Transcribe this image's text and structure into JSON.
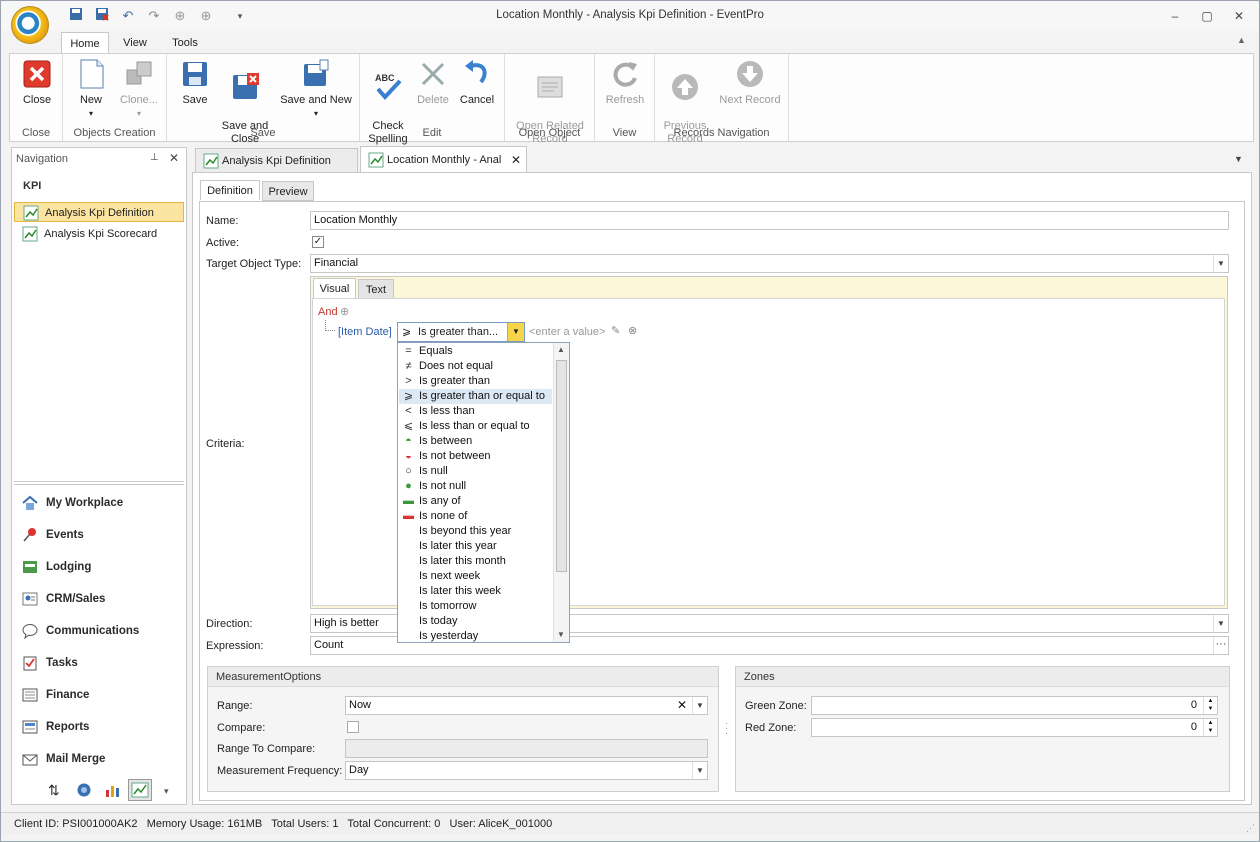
{
  "window": {
    "title": "Location Monthly - Analysis Kpi Definition - EventPro"
  },
  "ribbon_tabs": [
    "Home",
    "View",
    "Tools"
  ],
  "ribbon": {
    "close_group": {
      "label": "Close",
      "close": "Close"
    },
    "objects_group": {
      "label": "Objects Creation",
      "new": "New",
      "clone": "Clone..."
    },
    "save_group": {
      "label": "Save",
      "save": "Save",
      "save_close": "Save and\nClose",
      "save_new": "Save and New"
    },
    "edit_group": {
      "label": "Edit",
      "check": "Check\nSpelling",
      "delete": "Delete",
      "cancel": "Cancel"
    },
    "open_group": {
      "label": "Open Object",
      "open_related": "Open Related\nRecord"
    },
    "view_group": {
      "label": "View",
      "refresh": "Refresh"
    },
    "nav_group": {
      "label": "Records Navigation",
      "previous": "Previous\nRecord",
      "next": "Next Record"
    }
  },
  "navigation": {
    "header": "Navigation",
    "section": "KPI",
    "items": [
      "Analysis Kpi Definition",
      "Analysis Kpi Scorecard"
    ],
    "modules": [
      "My Workplace",
      "Events",
      "Lodging",
      "CRM/Sales",
      "Communications",
      "Tasks",
      "Finance",
      "Reports",
      "Mail Merge"
    ]
  },
  "doc_tabs": [
    "Analysis Kpi Definition",
    "Location Monthly - Anal"
  ],
  "sub_tabs": [
    "Definition",
    "Preview"
  ],
  "form": {
    "name_label": "Name:",
    "name_value": "Location Monthly",
    "active_label": "Active:",
    "active_checked": true,
    "target_label": "Target Object Type:",
    "target_value": "Financial",
    "criteria_label": "Criteria:",
    "criteria_tabs": [
      "Visual",
      "Text"
    ],
    "criteria_group": "And",
    "criteria_field": "[Item Date]",
    "criteria_operator": "Is greater than...",
    "criteria_value_placeholder": "<enter a value>",
    "direction_label": "Direction:",
    "direction_value": "High is better",
    "expression_label": "Expression:",
    "expression_value": "Count"
  },
  "operators": [
    {
      "label": "Equals",
      "icon": "equals-icon"
    },
    {
      "label": "Does not equal",
      "icon": "not-equal-icon"
    },
    {
      "label": "Is greater than",
      "icon": "greater-than-icon"
    },
    {
      "label": "Is greater than or equal to",
      "icon": "greater-equal-icon"
    },
    {
      "label": "Is less than",
      "icon": "less-than-icon"
    },
    {
      "label": "Is less than or equal to",
      "icon": "less-equal-icon"
    },
    {
      "label": "Is between",
      "icon": "between-icon"
    },
    {
      "label": "Is not between",
      "icon": "not-between-icon"
    },
    {
      "label": "Is null",
      "icon": "null-icon"
    },
    {
      "label": "Is not null",
      "icon": "not-null-icon"
    },
    {
      "label": "Is any of",
      "icon": "any-of-icon"
    },
    {
      "label": "Is none of",
      "icon": "none-of-icon"
    },
    {
      "label": "Is beyond this year",
      "icon": ""
    },
    {
      "label": "Is later this year",
      "icon": ""
    },
    {
      "label": "Is later this month",
      "icon": ""
    },
    {
      "label": "Is next week",
      "icon": ""
    },
    {
      "label": "Is later this week",
      "icon": ""
    },
    {
      "label": "Is tomorrow",
      "icon": ""
    },
    {
      "label": "Is today",
      "icon": ""
    },
    {
      "label": "Is yesterday",
      "icon": ""
    }
  ],
  "measurement": {
    "title": "MeasurementOptions",
    "range_label": "Range:",
    "range_value": "Now",
    "compare_label": "Compare:",
    "range_compare_label": "Range To Compare:",
    "frequency_label": "Measurement Frequency:",
    "frequency_value": "Day"
  },
  "zones": {
    "title": "Zones",
    "green_label": "Green Zone:",
    "green_value": "0",
    "red_label": "Red Zone:",
    "red_value": "0"
  },
  "status": "Client ID: PSI001000AK2   Memory Usage: 161MB   Total Users: 1   Total Concurrent: 0   User: AliceK_001000"
}
